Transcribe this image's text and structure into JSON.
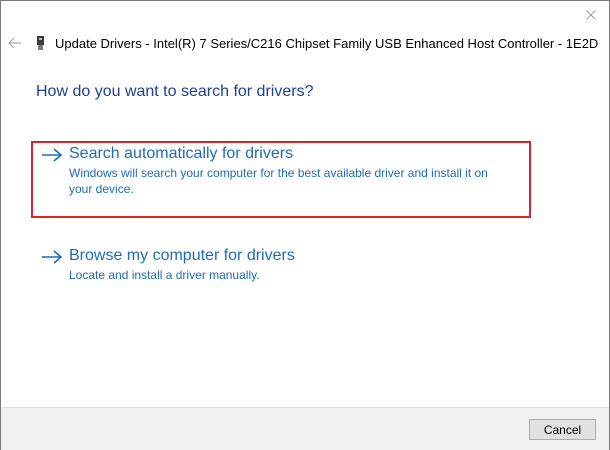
{
  "window": {
    "title": "Update Drivers - Intel(R) 7 Series/C216 Chipset Family USB Enhanced Host Controller - 1E2D",
    "close_icon": "close-icon",
    "back_icon": "back-arrow-icon",
    "device_icon": "usb-device-icon"
  },
  "main": {
    "heading": "How do you want to search for drivers?",
    "options": [
      {
        "title": "Search automatically for drivers",
        "description": "Windows will search your computer for the best available driver and install it on your device.",
        "icon": "arrow-right-icon",
        "highlighted": true
      },
      {
        "title": "Browse my computer for drivers",
        "description": "Locate and install a driver manually.",
        "icon": "arrow-right-icon",
        "highlighted": false
      }
    ]
  },
  "footer": {
    "cancel_label": "Cancel"
  },
  "colors": {
    "heading": "#1e3e9a",
    "link": "#1e6bb8",
    "highlight_border": "#d9232f",
    "footer_bg": "#f0f0f0"
  }
}
